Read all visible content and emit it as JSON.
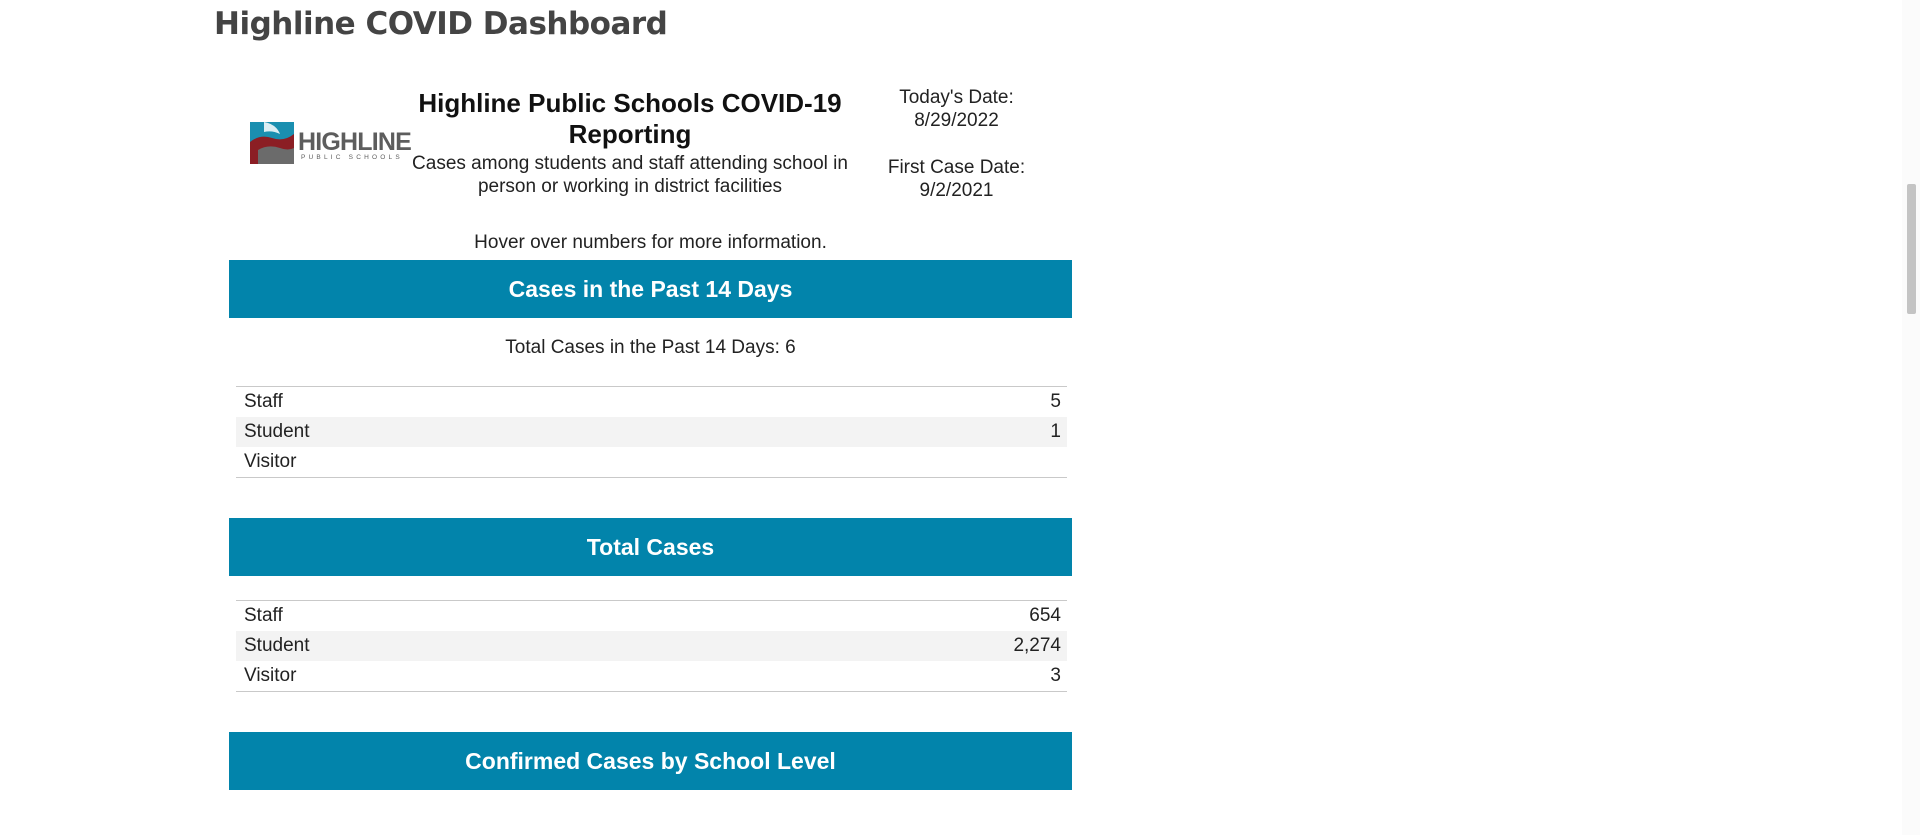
{
  "page": {
    "title": "Highline COVID Dashboard"
  },
  "report": {
    "logo_text": "HIGHLINE",
    "logo_subtext": "PUBLIC SCHOOLS",
    "title": "Highline Public Schools COVID-19 Reporting",
    "subtitle": "Cases among students and staff attending school in person or working in district facilities",
    "todays_date_label": "Today's Date:",
    "todays_date": "8/29/2022",
    "first_case_label": "First Case Date:",
    "first_case_date": "9/2/2021",
    "hover_note": "Hover over numbers for more information."
  },
  "past14": {
    "heading": "Cases in the Past 14 Days",
    "total_line": "Total Cases in the Past 14 Days: 6",
    "rows": [
      {
        "label": "Staff",
        "value": "5"
      },
      {
        "label": "Student",
        "value": "1"
      },
      {
        "label": "Visitor",
        "value": ""
      }
    ]
  },
  "total": {
    "heading": "Total Cases",
    "rows": [
      {
        "label": "Staff",
        "value": "654"
      },
      {
        "label": "Student",
        "value": "2,274"
      },
      {
        "label": "Visitor",
        "value": "3"
      }
    ]
  },
  "by_level": {
    "heading": "Confirmed Cases by School Level"
  },
  "colors": {
    "accent": "#0284ab",
    "logo_teal": "#1a8fb0",
    "logo_red": "#8b1e24",
    "logo_gray": "#6b6b6b"
  }
}
